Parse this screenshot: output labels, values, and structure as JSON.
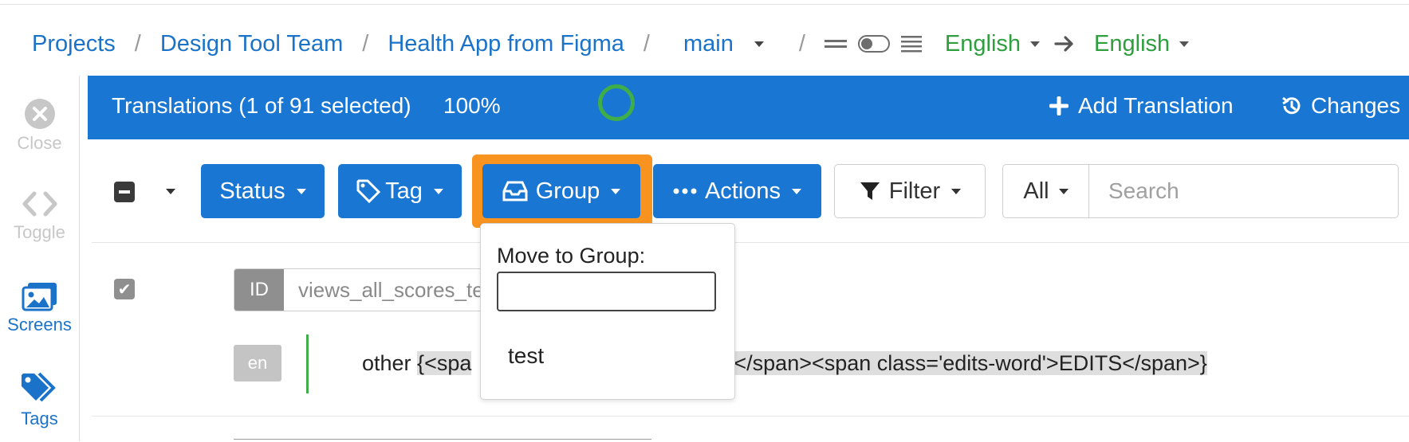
{
  "breadcrumb": {
    "items": [
      "Projects",
      "Design Tool Team",
      "Health App from Figma"
    ],
    "separator": "/",
    "branch": "main",
    "source_language": "English",
    "target_language": "English"
  },
  "sidebar": {
    "close_label": "Close",
    "toggle_label": "Toggle",
    "screens_label": "Screens",
    "tags_label": "Tags"
  },
  "header": {
    "title": "Translations (1 of 91 selected)",
    "progress_text": "100%",
    "progress_value": 1.0,
    "add_translation_label": "Add Translation",
    "changes_label": "Changes"
  },
  "toolbar": {
    "status_label": "Status",
    "tag_label": "Tag",
    "group_label": "Group",
    "actions_label": "Actions",
    "filter_label": "Filter",
    "scope_label": "All",
    "search_placeholder": "Search"
  },
  "group_dropdown": {
    "title": "Move to Group:",
    "input_value": "",
    "items": [
      "test"
    ]
  },
  "rows": [
    {
      "id_label": "ID",
      "id_value": "views_all_scores_te",
      "language": "en",
      "text_prefix": "other ",
      "text_code_left": "{<spa",
      "text_code_right": "#</span><span class='edits-word'>EDITS</span>}"
    }
  ],
  "colors": {
    "primary": "#1976d2",
    "accent_highlight": "#f7931e",
    "language_green": "#2e9e3e",
    "progress_ring": "#3fae49"
  }
}
